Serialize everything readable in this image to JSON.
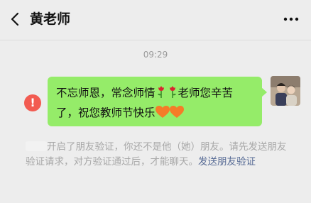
{
  "header": {
    "title": "黄老师",
    "back_icon": "chevron-left-icon",
    "more_icon": "more-horizontal-icon"
  },
  "chat": {
    "timestamp": "09:29",
    "message": {
      "text_part1": "不忘师恩，常念师情",
      "text_part2": "老师您辛苦了，祝您教师节快乐",
      "rose_icons": "rose-icon",
      "heart_icons": "orange-heart-icon",
      "status": "send-failed-icon",
      "status_symbol": "!"
    },
    "system_notice": {
      "text": "开启了朋友验证，你还不是他（她）朋友。请先发送朋友验证请求，对方验证通过后，才能聊天。",
      "link": "发送朋友验证"
    }
  },
  "colors": {
    "bubble": "#95ec69",
    "background": "#ededed",
    "error": "#f25b51",
    "link": "#576b95"
  }
}
